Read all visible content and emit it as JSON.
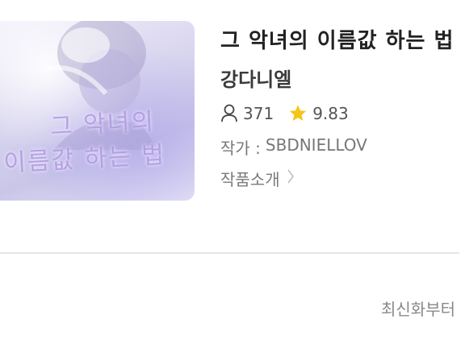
{
  "book": {
    "cover_title_line1": "그 악녀의",
    "cover_title_line2": "이름값 하는 법",
    "title": "그 악녀의 이름값 하는 법",
    "pairing": "강다니엘"
  },
  "stats": {
    "views_icon": "person-icon",
    "views": "371",
    "rating_icon": "star-icon",
    "rating": "9.83",
    "star_color": "#f5c518"
  },
  "writer": {
    "label": "작가 :",
    "name": "SBDNIELLOV"
  },
  "intro": {
    "label": "작품소개",
    "icon": "chevron-right-icon"
  },
  "sort": {
    "label": "최신화부터"
  }
}
